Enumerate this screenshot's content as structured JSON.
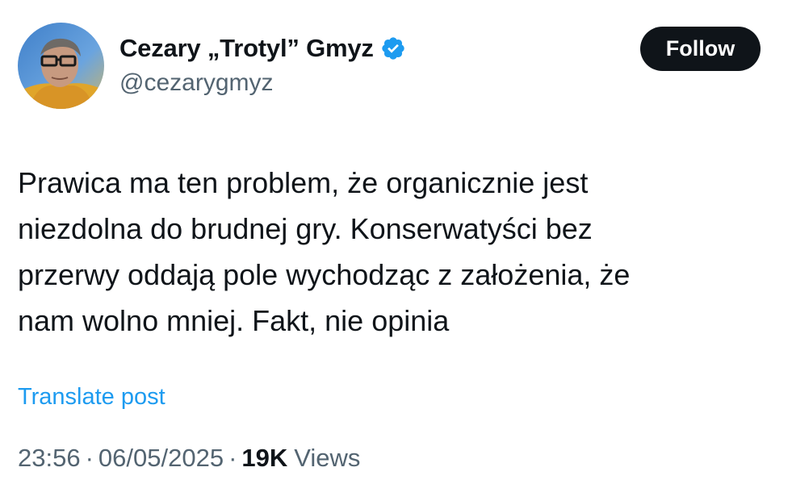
{
  "author": {
    "display_name": "Cezary „Trotyl” Gmyz",
    "handle": "@cezarygmyz",
    "verified": true,
    "verified_color": "#1d9bf0"
  },
  "follow_button": {
    "label": "Follow"
  },
  "tweet": {
    "text": "Prawica ma ten problem, że organicznie jest\nniezdolna do brudnej gry. Konserwatyści bez\nprzerwy oddają pole wychodząc z założenia, że\nnam wolno mniej. Fakt, nie opinia"
  },
  "translate": {
    "label": "Translate post"
  },
  "meta": {
    "time": "23:56",
    "separator": "·",
    "date": "06/05/2025",
    "views_count": "19K",
    "views_label": "Views"
  },
  "colors": {
    "text_primary": "#0f1419",
    "text_secondary": "#536471",
    "link": "#1d9bf0",
    "button_bg": "#0f1419"
  }
}
